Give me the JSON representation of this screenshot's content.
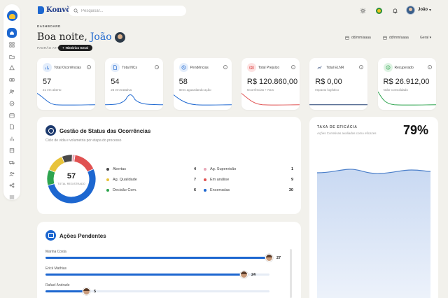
{
  "app": {
    "brand": "Konvèz",
    "search_placeholder": "Pesquisar...",
    "user_name": "João",
    "colors": {
      "primary": "#1d67d0",
      "navy": "#1d3a6e",
      "background": "#f2f1ec"
    }
  },
  "sidebar": {
    "items": [
      {
        "icon": "home-icon",
        "active": true
      },
      {
        "icon": "grid-icon"
      },
      {
        "icon": "folder-icon"
      },
      {
        "icon": "warning-icon"
      },
      {
        "icon": "money-icon"
      },
      {
        "icon": "users-icon"
      },
      {
        "icon": "check-circle-icon"
      },
      {
        "icon": "calendar-icon"
      },
      {
        "icon": "file-icon"
      },
      {
        "icon": "chart-icon"
      },
      {
        "icon": "box-icon"
      },
      {
        "icon": "truck-icon"
      },
      {
        "icon": "user-plus-icon"
      },
      {
        "icon": "share-icon"
      },
      {
        "icon": "menu-icon"
      }
    ]
  },
  "header": {
    "eyebrow": "DASHBOARD",
    "greeting": "Boa noite,",
    "name": "João",
    "pattern_label": "PADRÃO ATIVO:",
    "history_button": "Histórico Geral",
    "date_from": "dd/mm/aaaa",
    "date_to": "dd/mm/aaaa",
    "scope_select": "Geral"
  },
  "kpis": [
    {
      "title": "Total Ocorrências",
      "value": "57",
      "sub": "21 em aberto",
      "color": "#1d67d0",
      "icon": "chart-icon",
      "icon_bg": "#e3edfb"
    },
    {
      "title": "Total NCs",
      "value": "54",
      "sub": "26 em tratativa",
      "color": "#1d67d0",
      "icon": "file-icon",
      "icon_bg": "#e3edfb"
    },
    {
      "title": "Pendências",
      "value": "58",
      "sub": "Itens aguardando ação",
      "color": "#1d67d0",
      "icon": "clock-icon",
      "icon_bg": "#e3edfb"
    },
    {
      "title": "Total Prejuízo",
      "value": "R$ 120.860,00",
      "sub": "Ocorrências + NCs",
      "color": "#e05252",
      "icon": "money-icon",
      "icon_bg": "#fde3e3"
    },
    {
      "title": "Total ELNR",
      "value": "R$ 0,00",
      "sub": "Impacto logístico",
      "color": "#1d3a6e",
      "icon": "trend-icon",
      "icon_bg": "#ffffff"
    },
    {
      "title": "Recuperado",
      "value": "R$ 26.912,00",
      "sub": "Valor consolidado",
      "color": "#2da44e",
      "icon": "dollar-icon",
      "icon_bg": "#def3e3"
    }
  ],
  "status": {
    "title": "Gestão de Status das Ocorrências",
    "subtitle": "Ciclo de vida e volumetria por etapa do processo",
    "total": "57",
    "total_caption": "TOTAL REGISTRADO",
    "items": [
      {
        "label": "Abertas",
        "value": 4,
        "color": "#4a4a4a"
      },
      {
        "label": "Ag. Qualidade",
        "value": 7,
        "color": "#e8c33a"
      },
      {
        "label": "Decisão Com.",
        "value": 6,
        "color": "#2da44e"
      },
      {
        "label": "Ag. Supervisão",
        "value": 1,
        "color": "#e8a8b8"
      },
      {
        "label": "Em análise",
        "value": 9,
        "color": "#e05252"
      },
      {
        "label": "Encerradas",
        "value": 30,
        "color": "#1d67d0"
      }
    ]
  },
  "pending": {
    "title": "Ações Pendentes",
    "max": 27,
    "rows": [
      {
        "name": "Marina Costa",
        "count": 27
      },
      {
        "name": "Erick Mathias",
        "count": 24
      },
      {
        "name": "Rafael Andrade",
        "count": 5
      }
    ]
  },
  "efficacy": {
    "title": "TAXA DE EFICÁCIA",
    "subtitle": "Ações Corretivas avaliadas como eficazes",
    "value": "79%",
    "percent": 79
  }
}
